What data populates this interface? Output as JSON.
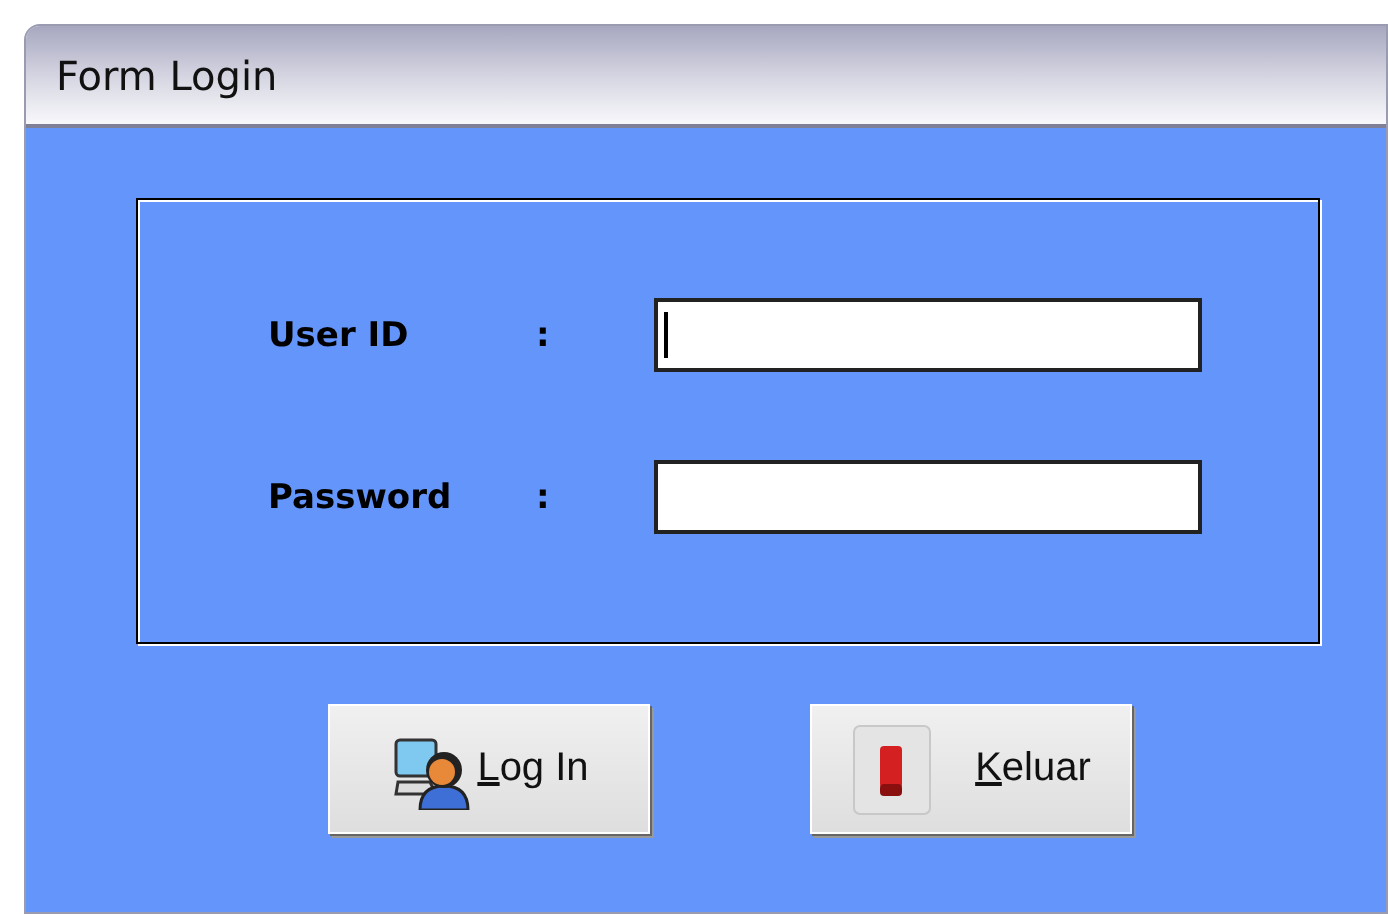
{
  "window": {
    "title": "Form Login"
  },
  "fields": [
    {
      "label": "User ID",
      "separator": ":",
      "focused": true
    },
    {
      "label": "Password",
      "separator": ":",
      "focused": false
    }
  ],
  "buttons": [
    {
      "label": "Log In",
      "first_letter_underlined": true,
      "kind": "login"
    },
    {
      "label": "Keluar",
      "first_letter_underlined": true,
      "kind": "exit"
    }
  ]
}
